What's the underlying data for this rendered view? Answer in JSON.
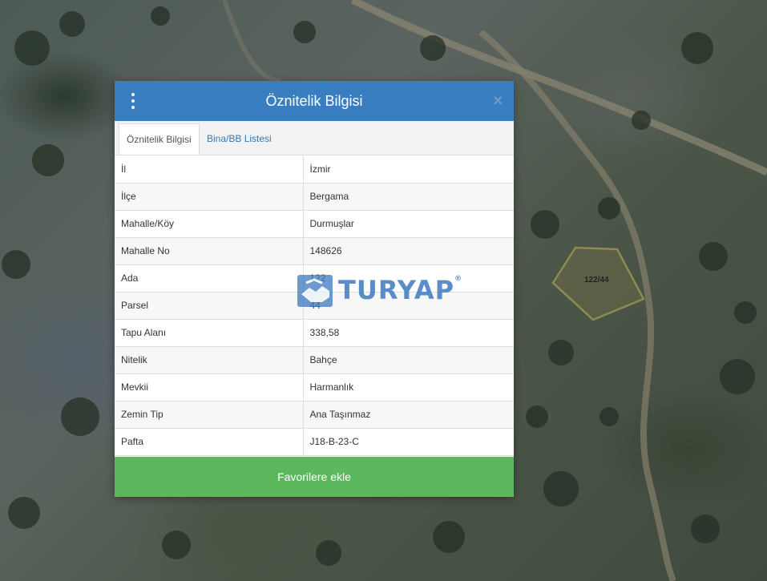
{
  "map": {
    "parcel_label": "122/44"
  },
  "dialog": {
    "title": "Öznitelik Bilgisi",
    "close": "×",
    "tabs": [
      {
        "label": "Öznitelik Bilgisi",
        "active": true
      },
      {
        "label": "Bina/BB Listesi",
        "active": false
      }
    ],
    "rows": [
      {
        "key": "İl",
        "value": "İzmir"
      },
      {
        "key": "İlçe",
        "value": "Bergama"
      },
      {
        "key": "Mahalle/Köy",
        "value": "Durmuşlar"
      },
      {
        "key": "Mahalle No",
        "value": "148626"
      },
      {
        "key": "Ada",
        "value": "122"
      },
      {
        "key": "Parsel",
        "value": "44"
      },
      {
        "key": "Tapu Alanı",
        "value": "338,58"
      },
      {
        "key": "Nitelik",
        "value": "Bahçe"
      },
      {
        "key": "Mevkii",
        "value": "Harmanlık"
      },
      {
        "key": "Zemin Tip",
        "value": "Ana Taşınmaz"
      },
      {
        "key": "Pafta",
        "value": "J18-B-23-C"
      }
    ],
    "favorite_button": "Favorilere ekle"
  },
  "watermark": {
    "text": "TURYAP",
    "mark": "®"
  },
  "colors": {
    "header": "#3a7ec2",
    "button": "#5cb85c",
    "link": "#337ab7"
  }
}
